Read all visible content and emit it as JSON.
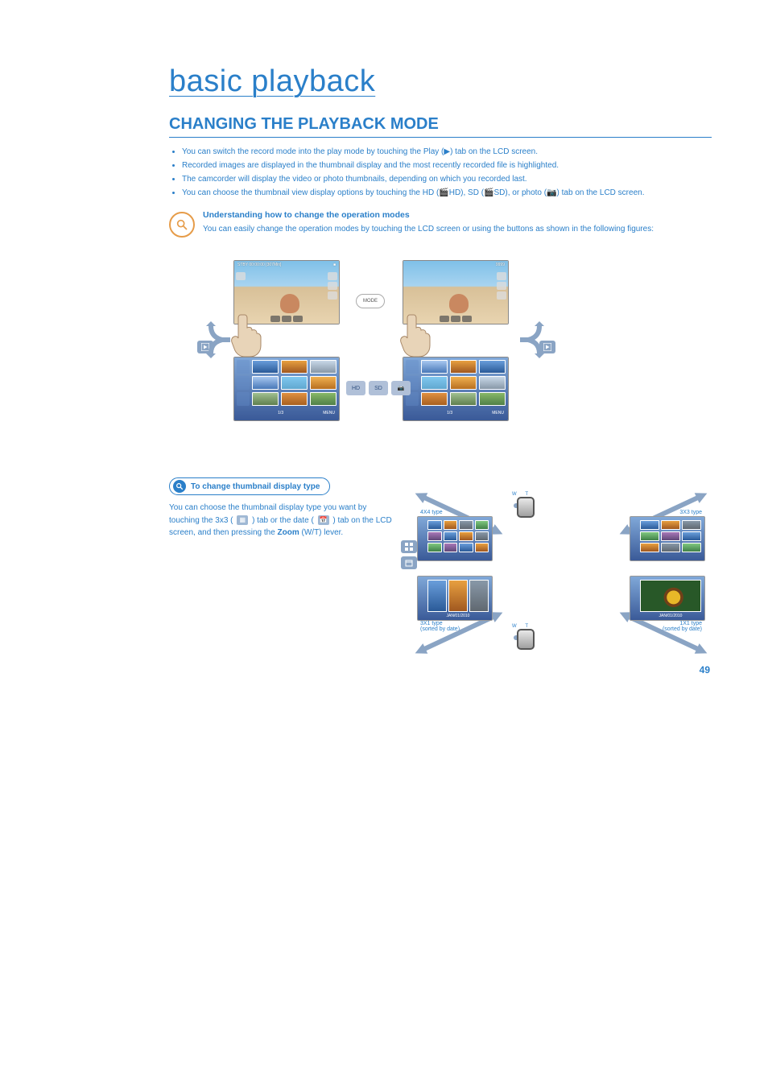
{
  "chapter_title": "basic playback",
  "section_title": "CHANGING THE PLAYBACK MODE",
  "intro_bullets": [
    "You can switch the record mode into the play mode by touching the Play (▶) tab on the LCD screen.",
    "Recorded images are displayed in the thumbnail display and the most recently recorded file is highlighted.",
    "The camcorder will display the video or photo thumbnails, depending on which you recorded last.",
    "You can choose the thumbnail view display options by touching the HD (🎬HD), SD (🎬SD), or photo (📷) tab on the LCD screen."
  ],
  "note": {
    "title": "Understanding how to change the operation modes",
    "text": "You can easily change the operation modes by touching the LCD screen or using the buttons as shown in the following figures:"
  },
  "diagram": {
    "rec_osd_top": "STBY 00:00:00 [307Min]",
    "rec_osd_top_right": "9999",
    "mode_button": "MODE",
    "playback_icon": "▶",
    "media_tabs": [
      "HD",
      "SD",
      "📷"
    ],
    "thumb_footer_left": "1/3",
    "thumb_footer_right": "MENU"
  },
  "subsection_title": "To change thumbnail display type",
  "subsection_text_pre": "You can choose the thumbnail display type you want by touching the 3x3 (",
  "subsection_text_mid": ") tab or the date (",
  "subsection_text_post": ") tab on the LCD screen, and then pressing the ",
  "zoom_label": "Zoom",
  "subsection_text_end": " (W/T) lever.",
  "zoom": {
    "w": "W",
    "t": "T"
  },
  "type_labels": {
    "l1": "4X4 type",
    "l2": "3X3 type",
    "l3": "3X1 type\n(sorted by date)",
    "l4": "1X1 type\n(sorted by date)"
  },
  "date_example": "JAN/01/2010",
  "page_number": "49"
}
